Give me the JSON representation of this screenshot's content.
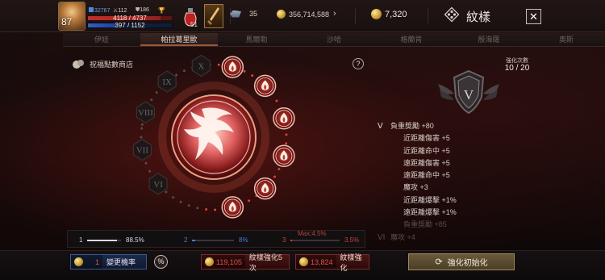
{
  "player": {
    "level": "87",
    "stat_a": "32767",
    "stat_b": "112",
    "stat_c": "186",
    "hp_text": "4118 / 4737",
    "hp_ratio": 0.87,
    "mp_text": "397 / 1152",
    "mp_ratio": 0.34,
    "potion_count": "51"
  },
  "currency": {
    "gems": "35",
    "gold": "356,714,588",
    "coins": "7,320"
  },
  "header": {
    "title": "紋樣"
  },
  "tabs": [
    {
      "label": "伊娃",
      "active": false
    },
    {
      "label": "帕拉葛里歐",
      "active": true
    },
    {
      "label": "馬爾勒",
      "active": false
    },
    {
      "label": "沙哈",
      "active": false
    },
    {
      "label": "格蘭肯",
      "active": false
    },
    {
      "label": "殷海薩",
      "active": false
    },
    {
      "label": "奧斯",
      "active": false
    }
  ],
  "shop": {
    "label": "祝福點數商店"
  },
  "ring": {
    "roman": [
      "X",
      "IX",
      "VIII",
      "VII",
      "VI"
    ]
  },
  "enhance": {
    "label": "強化次數",
    "value": "10 / 20",
    "grade": "V"
  },
  "effects": [
    {
      "roman": "V",
      "text": "負重獎勵 +80",
      "sub": false,
      "dim": false
    },
    {
      "roman": "",
      "text": "近距離傷害 +5",
      "sub": true,
      "dim": false
    },
    {
      "roman": "",
      "text": "近距離命中 +5",
      "sub": true,
      "dim": false
    },
    {
      "roman": "",
      "text": "遠距離傷害 +5",
      "sub": true,
      "dim": false
    },
    {
      "roman": "",
      "text": "遠距離命中 +5",
      "sub": true,
      "dim": false
    },
    {
      "roman": "",
      "text": "魔攻 +3",
      "sub": true,
      "dim": false
    },
    {
      "roman": "",
      "text": "近距離爆擊 +1%",
      "sub": true,
      "dim": false
    },
    {
      "roman": "",
      "text": "遠距離爆擊 +1%",
      "sub": true,
      "dim": false
    },
    {
      "roman": "",
      "text": "負重獎勵 +85",
      "sub": true,
      "dim": true
    },
    {
      "roman": "VI",
      "text": "魔攻 +4",
      "sub": false,
      "dim": true
    }
  ],
  "probability": {
    "max_label": "Max:4.5%",
    "items": [
      {
        "index": "1",
        "value": "88.5%",
        "ratio": 0.885,
        "color": "#d8d8e0"
      },
      {
        "index": "2",
        "value": "8%",
        "ratio": 0.08,
        "color": "#4a7ad8"
      },
      {
        "index": "3",
        "value": "3.5%",
        "ratio": 0.035,
        "color": "#d04040"
      }
    ]
  },
  "bottom": {
    "chance_cost": "1",
    "chance_label": "變更機率",
    "pct_label": "%",
    "enhance5_cost": "119,105",
    "enhance5_label": "紋樣強化5次",
    "enhance_cost": "13,824",
    "enhance_label": "紋樣強化",
    "reset_label": "強化初始化"
  },
  "colors": {
    "accent_red": "#c0302a",
    "gold": "#c89a2a",
    "active_tab_underline": "#9a5a3a"
  }
}
